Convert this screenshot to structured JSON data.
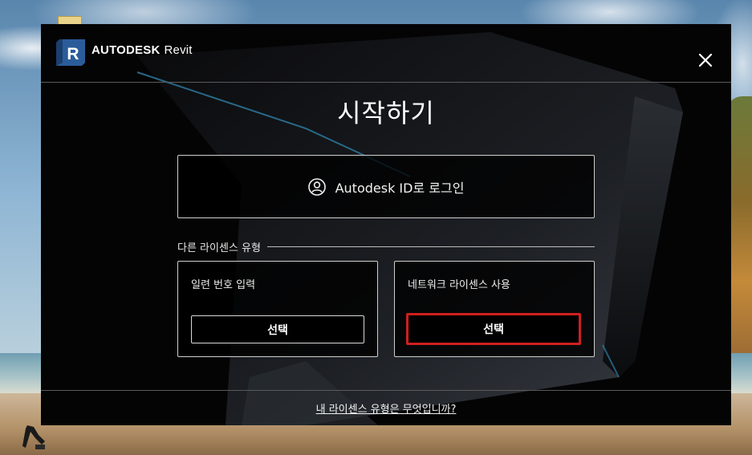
{
  "window": {
    "brand_bold": "AUTODESK",
    "brand_product": "Revit",
    "logo_letter": "R",
    "close_icon": "close-icon"
  },
  "main": {
    "title": "시작하기",
    "signin_label": "Autodesk ID로 로그인",
    "signin_icon": "user-circle-icon"
  },
  "other_license": {
    "section_label": "다른 라이센스 유형",
    "cards": [
      {
        "title": "일련 번호 입력",
        "button_label": "선택",
        "highlighted": false
      },
      {
        "title": "네트워크 라이센스 사용",
        "button_label": "선택",
        "highlighted": true
      }
    ]
  },
  "footer": {
    "link_label": "내 라이센스 유형은 무엇입니까?"
  },
  "colors": {
    "dialog_bg": "#050405",
    "highlight": "#d01f1f",
    "logo_blue": "#2b5c9a"
  }
}
